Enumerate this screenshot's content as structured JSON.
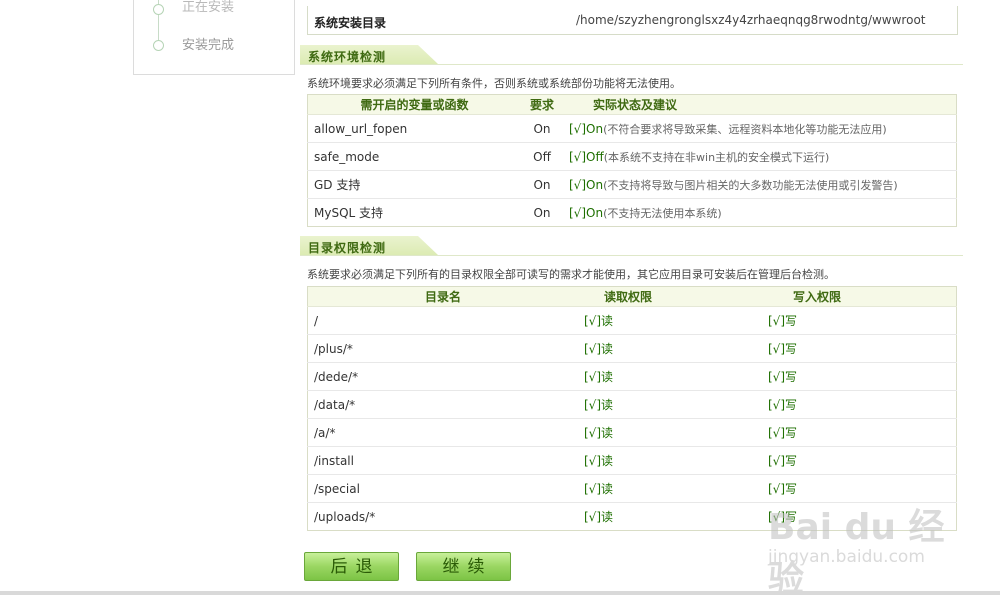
{
  "sidebar": {
    "prev_step": "正在安装",
    "current_step": "安装完成"
  },
  "install_dir": {
    "label": "系统安装目录",
    "value": "/home/szyzhengronglsxz4y4zrhaeqnqg8rwodntg/wwwroot"
  },
  "env_section": {
    "title": "系统环境检测",
    "description": "系统环境要求必须满足下列所有条件，否则系统或系统部份功能将无法使用。",
    "headers": [
      "需开启的变量或函数",
      "要求",
      "实际状态及建议"
    ],
    "rows": [
      {
        "name": "allow_url_fopen",
        "req": "On",
        "status": "[√]On",
        "note": "(不符合要求将导致采集、远程资料本地化等功能无法应用)"
      },
      {
        "name": "safe_mode",
        "req": "Off",
        "status": "[√]Off",
        "note": "(本系统不支持在非win主机的安全模式下运行)"
      },
      {
        "name": "GD 支持",
        "req": "On",
        "status": "[√]On",
        "note": "(不支持将导致与图片相关的大多数功能无法使用或引发警告)"
      },
      {
        "name": "MySQL 支持",
        "req": "On",
        "status": "[√]On",
        "note": "(不支持无法使用本系统)"
      }
    ]
  },
  "perm_section": {
    "title": "目录权限检测",
    "description": "系统要求必须满足下列所有的目录权限全部可读写的需求才能使用，其它应用目录可安装后在管理后台检测。",
    "headers": [
      "目录名",
      "读取权限",
      "写入权限"
    ],
    "rows": [
      {
        "dir": "/",
        "read": "[√]读",
        "write": "[√]写"
      },
      {
        "dir": "/plus/*",
        "read": "[√]读",
        "write": "[√]写"
      },
      {
        "dir": "/dede/*",
        "read": "[√]读",
        "write": "[√]写"
      },
      {
        "dir": "/data/*",
        "read": "[√]读",
        "write": "[√]写"
      },
      {
        "dir": "/a/*",
        "read": "[√]读",
        "write": "[√]写"
      },
      {
        "dir": "/install",
        "read": "[√]读",
        "write": "[√]写"
      },
      {
        "dir": "/special",
        "read": "[√]读",
        "write": "[√]写"
      },
      {
        "dir": "/uploads/*",
        "read": "[√]读",
        "write": "[√]写"
      }
    ]
  },
  "buttons": {
    "back": "后退",
    "next": "继续"
  },
  "watermark": {
    "brand": "Bai du 经验",
    "url": "jingyan.baidu.com"
  }
}
